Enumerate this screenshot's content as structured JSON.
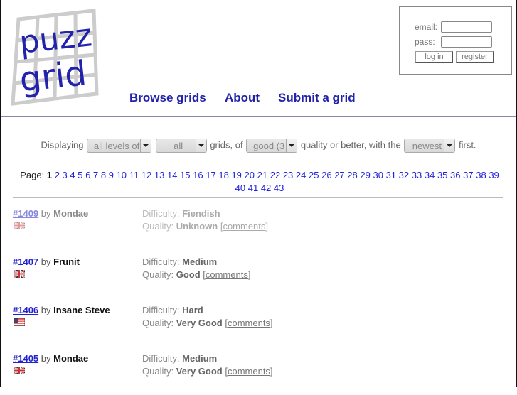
{
  "site": {
    "logo_line1": "puzz",
    "logo_line2": "grid",
    "brand_color": "#2222aa"
  },
  "nav": {
    "items": [
      {
        "label": "Browse grids"
      },
      {
        "label": "About"
      },
      {
        "label": "Submit a grid"
      }
    ]
  },
  "login": {
    "email_label": "email:",
    "email_value": "",
    "pass_label": "pass:",
    "pass_value": "",
    "login_button": "log in",
    "register_button": "register"
  },
  "filters": {
    "prefix": "Displaying",
    "difficulty_select": "all levels of",
    "type_select": "all",
    "mid1": "grids, of",
    "quality_select": "good (3",
    "mid2": "quality or better, with the",
    "order_select": "newest",
    "suffix": "first."
  },
  "pagination": {
    "label": "Page:",
    "current": "1",
    "pages": [
      "2",
      "3",
      "4",
      "5",
      "6",
      "7",
      "8",
      "9",
      "10",
      "11",
      "12",
      "13",
      "14",
      "15",
      "16",
      "17",
      "18",
      "19",
      "20",
      "21",
      "22",
      "23",
      "24",
      "25",
      "26",
      "27",
      "28",
      "29",
      "30",
      "31",
      "32",
      "33",
      "34",
      "35",
      "36",
      "37",
      "38",
      "39",
      "40",
      "41",
      "42",
      "43"
    ]
  },
  "entries": [
    {
      "id": "#1409",
      "by": "by",
      "author": "Mondae",
      "flag": "uk-flag",
      "difficulty_label": "Difficulty:",
      "difficulty": "Fiendish",
      "quality_label": "Quality:",
      "quality": "Unknown",
      "comments": "[comments]",
      "faded": true
    },
    {
      "id": "#1407",
      "by": "by",
      "author": "Frunit",
      "flag": "uk-flag",
      "difficulty_label": "Difficulty:",
      "difficulty": "Medium",
      "quality_label": "Quality:",
      "quality": "Good",
      "comments": "[comments]",
      "faded": false
    },
    {
      "id": "#1406",
      "by": "by",
      "author": "Insane Steve",
      "flag": "us-flag",
      "difficulty_label": "Difficulty:",
      "difficulty": "Hard",
      "quality_label": "Quality:",
      "quality": "Very Good",
      "comments": "[comments]",
      "faded": false
    },
    {
      "id": "#1405",
      "by": "by",
      "author": "Mondae",
      "flag": "uk-flag",
      "difficulty_label": "Difficulty:",
      "difficulty": "Medium",
      "quality_label": "Quality:",
      "quality": "Very Good",
      "comments": "[comments]",
      "faded": false
    }
  ]
}
